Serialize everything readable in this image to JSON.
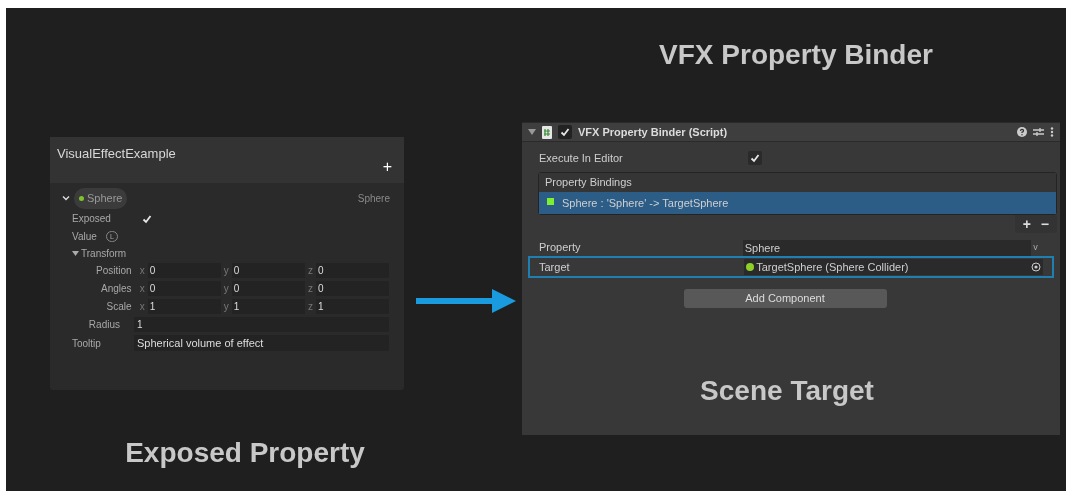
{
  "left": {
    "caption": "Exposed Property",
    "panel": {
      "title": "VisualEffectExample",
      "add": "+",
      "property": {
        "name": "Sphere",
        "type": "Sphere",
        "expanded": true,
        "exposed_label": "Exposed",
        "exposed": true,
        "value_label": "Value",
        "value_badge": "L",
        "transform_label": "Transform",
        "transform_expanded": true,
        "vectors": [
          {
            "label": "Position",
            "fields": [
              {
                "axis": "x",
                "value": "0"
              },
              {
                "axis": "y",
                "value": "0"
              },
              {
                "axis": "z",
                "value": "0"
              }
            ]
          },
          {
            "label": "Angles",
            "fields": [
              {
                "axis": "x",
                "value": "0"
              },
              {
                "axis": "y",
                "value": "0"
              },
              {
                "axis": "z",
                "value": "0"
              }
            ]
          },
          {
            "label": "Scale",
            "fields": [
              {
                "axis": "x",
                "value": "1"
              },
              {
                "axis": "y",
                "value": "1"
              },
              {
                "axis": "z",
                "value": "1"
              }
            ]
          }
        ],
        "radius_label": "Radius",
        "radius": "1",
        "tooltip_label": "Tooltip",
        "tooltip": "Spherical volume of effect"
      }
    }
  },
  "right": {
    "heading": "VFX Property Binder",
    "caption": "Scene Target",
    "panel": {
      "component": {
        "title": "VFX Property Binder (Script)",
        "enabled": true,
        "expanded": true
      },
      "execute_label": "Execute In Editor",
      "execute": true,
      "bindings_title": "Property Bindings",
      "bindings": [
        {
          "label": "Sphere : 'Sphere' -> TargetSphere",
          "selected": true
        }
      ],
      "add": "+",
      "remove": "−",
      "property_label": "Property",
      "property": "Sphere",
      "property_dropdown": "v",
      "target_label": "Target",
      "target": "TargetSphere (Sphere Collider)",
      "add_component": "Add Component"
    }
  }
}
